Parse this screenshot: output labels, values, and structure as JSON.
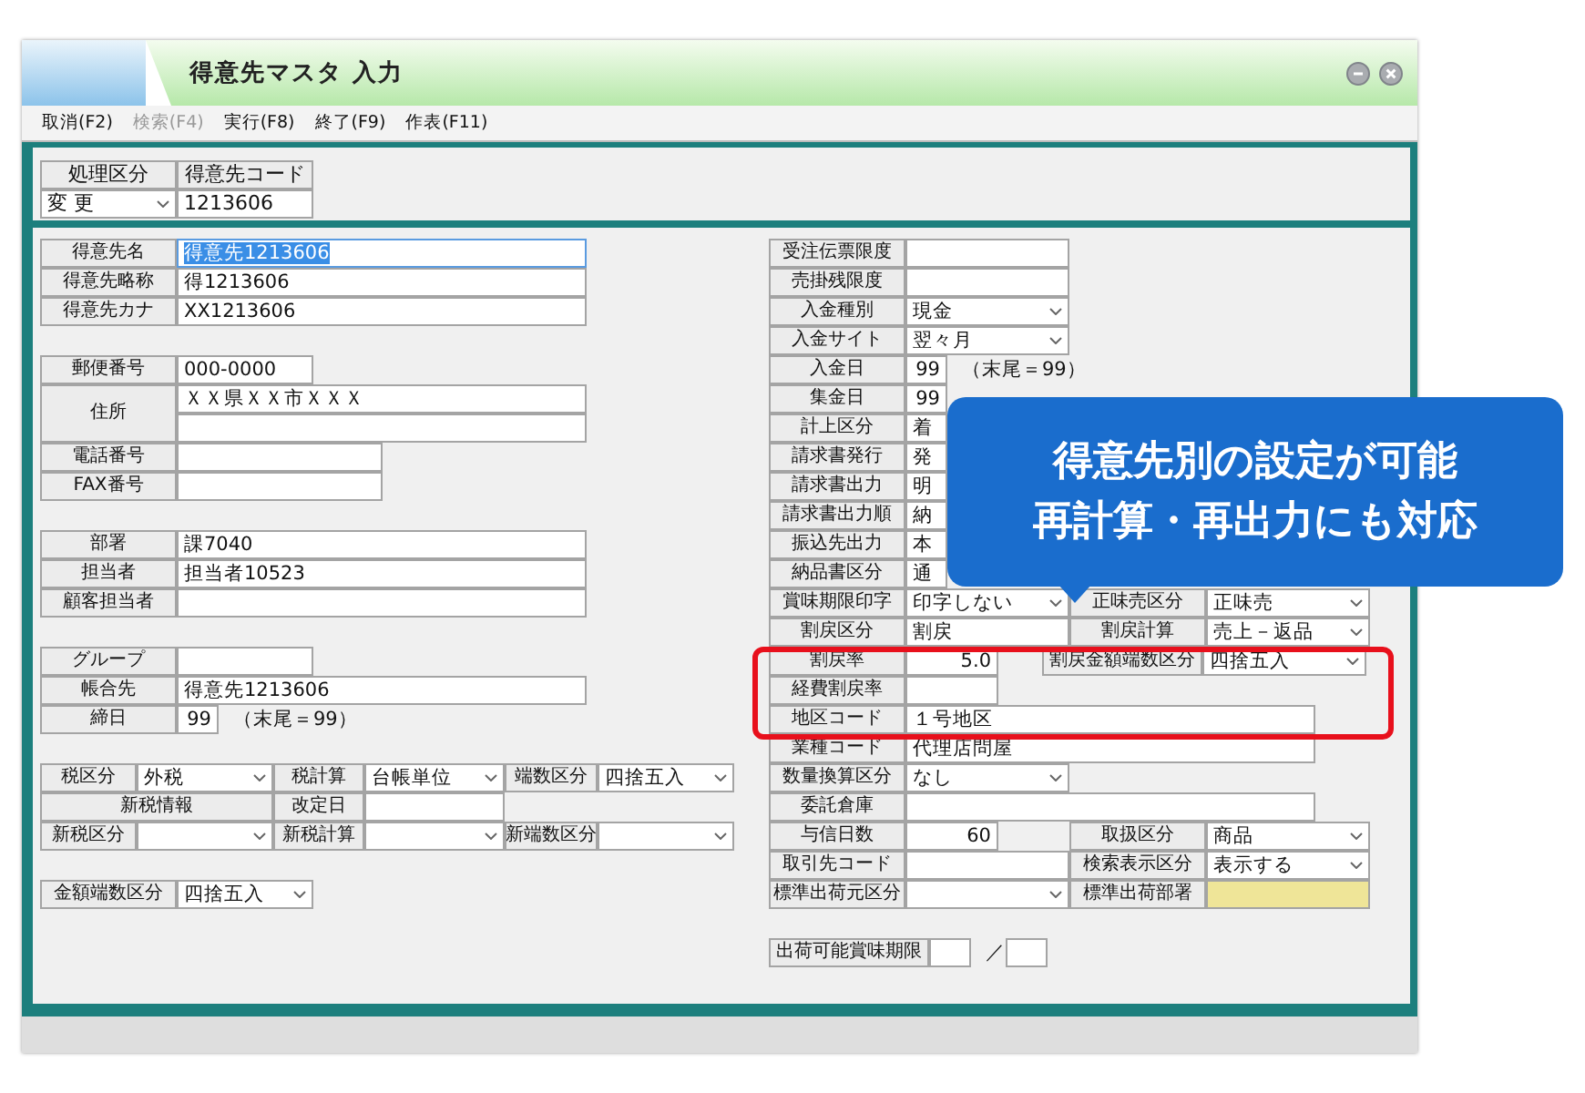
{
  "window": {
    "title": "得意先マスタ 入力"
  },
  "menu": [
    {
      "label": "取消(F2)",
      "disabled": false
    },
    {
      "label": "検索(F4)",
      "disabled": true
    },
    {
      "label": "実行(F8)",
      "disabled": false
    },
    {
      "label": "終了(F9)",
      "disabled": false
    },
    {
      "label": "作表(F11)",
      "disabled": false
    }
  ],
  "header": {
    "rows": [
      {
        "kind": "line",
        "cells": [
          {
            "kind": "label",
            "text": "処理区分"
          },
          {
            "kind": "label",
            "text": "得意先コード"
          }
        ]
      },
      {
        "kind": "line",
        "cells": [
          {
            "kind": "select",
            "value": "変 更"
          },
          {
            "kind": "input",
            "value": "1213606"
          }
        ]
      }
    ]
  },
  "left_groups": [
    [
      {
        "kind": "line",
        "cells": [
          {
            "kind": "label",
            "text": "得意先名"
          },
          {
            "kind": "input",
            "value": "得意先1213606",
            "focused": true
          }
        ]
      },
      {
        "kind": "line",
        "cells": [
          {
            "kind": "label",
            "text": "得意先略称"
          },
          {
            "kind": "input",
            "value": "得1213606",
            "focused": false
          }
        ]
      },
      {
        "kind": "line",
        "cells": [
          {
            "kind": "label",
            "text": "得意先カナ"
          },
          {
            "kind": "input",
            "value": "XX1213606",
            "focused": false
          }
        ]
      }
    ],
    [
      {
        "kind": "line",
        "cells": [
          {
            "kind": "label",
            "text": "郵便番号"
          },
          {
            "kind": "input",
            "value": "000-0000"
          }
        ]
      },
      {
        "kind": "stack",
        "cells": [
          {
            "kind": "label",
            "text": "住所"
          },
          {
            "kind": "input",
            "value": "ＸＸ県ＸＸ市ＸＸＸ"
          },
          {
            "kind": "input"
          }
        ]
      },
      {
        "kind": "line",
        "cells": [
          {
            "kind": "label",
            "text": "電話番号"
          },
          {
            "kind": "input"
          }
        ]
      },
      {
        "kind": "line",
        "cells": [
          {
            "kind": "label",
            "text": "FAX番号"
          },
          {
            "kind": "input"
          }
        ]
      }
    ],
    [
      {
        "kind": "line",
        "cells": [
          {
            "kind": "label",
            "text": "部署"
          },
          {
            "kind": "input",
            "value": "課7040"
          }
        ]
      },
      {
        "kind": "line",
        "cells": [
          {
            "kind": "label",
            "text": "担当者"
          },
          {
            "kind": "input",
            "value": "担当者10523"
          }
        ]
      },
      {
        "kind": "line",
        "cells": [
          {
            "kind": "label",
            "text": "顧客担当者"
          },
          {
            "kind": "input"
          }
        ]
      }
    ],
    [
      {
        "kind": "line",
        "cells": [
          {
            "kind": "label",
            "text": "グループ"
          },
          {
            "kind": "input"
          }
        ]
      },
      {
        "kind": "line",
        "cells": [
          {
            "kind": "label",
            "text": "帳合先"
          },
          {
            "kind": "input",
            "value": "得意先1213606"
          }
        ]
      },
      {
        "kind": "line",
        "cells": [
          {
            "kind": "label",
            "text": "締日"
          },
          {
            "kind": "number",
            "value": "99"
          },
          {
            "kind": "note",
            "text": "（末尾＝99）"
          }
        ]
      }
    ],
    [
      {
        "kind": "line",
        "cells": [
          {
            "kind": "label",
            "text": "税区分"
          },
          {
            "kind": "select",
            "value": "外税"
          },
          {
            "kind": "label",
            "text": "税計算"
          },
          {
            "kind": "select",
            "value": "台帳単位"
          },
          {
            "kind": "label",
            "text": "端数区分"
          },
          {
            "kind": "select",
            "value": "四捨五入"
          }
        ]
      },
      {
        "kind": "line",
        "cells": [
          {
            "kind": "label",
            "text": "新税情報"
          },
          {
            "kind": "label",
            "text": "改定日"
          },
          {
            "kind": "input"
          }
        ]
      },
      {
        "kind": "line",
        "cells": [
          {
            "kind": "label",
            "text": "新税区分"
          },
          {
            "kind": "select"
          },
          {
            "kind": "label",
            "text": "新税計算"
          },
          {
            "kind": "select"
          },
          {
            "kind": "label",
            "text": "新端数区分"
          },
          {
            "kind": "select"
          }
        ]
      }
    ],
    [
      {
        "kind": "line",
        "cells": [
          {
            "kind": "label",
            "text": "金額端数区分"
          },
          {
            "kind": "select",
            "value": "四捨五入"
          }
        ]
      }
    ]
  ],
  "right_rows": [
    {
      "kind": "line",
      "cells": [
        {
          "kind": "label",
          "text": "受注伝票限度"
        },
        {
          "kind": "input"
        }
      ]
    },
    {
      "kind": "line",
      "cells": [
        {
          "kind": "label",
          "text": "売掛残限度"
        },
        {
          "kind": "input"
        }
      ]
    },
    {
      "kind": "line",
      "cells": [
        {
          "kind": "label",
          "text": "入金種別"
        },
        {
          "kind": "select",
          "value": "現金"
        }
      ]
    },
    {
      "kind": "line",
      "cells": [
        {
          "kind": "label",
          "text": "入金サイト"
        },
        {
          "kind": "select",
          "value": "翌々月"
        }
      ]
    },
    {
      "kind": "line",
      "cells": [
        {
          "kind": "label",
          "text": "入金日"
        },
        {
          "kind": "number",
          "value": "99"
        },
        {
          "kind": "note",
          "text": "（末尾＝99）"
        }
      ]
    },
    {
      "kind": "line",
      "cells": [
        {
          "kind": "label",
          "text": "集金日"
        },
        {
          "kind": "number",
          "value": "99"
        }
      ]
    },
    {
      "kind": "line",
      "cells": [
        {
          "kind": "label",
          "text": "計上区分"
        },
        {
          "kind": "input",
          "value": "着"
        }
      ]
    },
    {
      "kind": "line",
      "cells": [
        {
          "kind": "label",
          "text": "請求書発行"
        },
        {
          "kind": "input",
          "value": "発"
        }
      ]
    },
    {
      "kind": "line",
      "cells": [
        {
          "kind": "label",
          "text": "請求書出力"
        },
        {
          "kind": "input",
          "value": "明"
        }
      ]
    },
    {
      "kind": "line",
      "cells": [
        {
          "kind": "label",
          "text": "請求書出力順"
        },
        {
          "kind": "input",
          "value": "納"
        }
      ]
    },
    {
      "kind": "line",
      "cells": [
        {
          "kind": "label",
          "text": "振込先出力"
        },
        {
          "kind": "input",
          "value": "本"
        }
      ]
    },
    {
      "kind": "line",
      "cells": [
        {
          "kind": "label",
          "text": "納品書区分"
        },
        {
          "kind": "input",
          "value": "通"
        }
      ]
    },
    {
      "kind": "line",
      "cells": [
        {
          "kind": "label",
          "text": "賞味期限印字"
        },
        {
          "kind": "select",
          "value": "印字しない"
        },
        {
          "kind": "label",
          "text": "正味売区分"
        },
        {
          "kind": "select",
          "value": "正味売"
        }
      ]
    },
    {
      "kind": "line",
      "cells": [
        {
          "kind": "label",
          "text": "割戻区分"
        },
        {
          "kind": "input",
          "value": "割戻"
        },
        {
          "kind": "label",
          "text": "割戻計算"
        },
        {
          "kind": "select",
          "value": "売上－返品"
        }
      ]
    },
    {
      "kind": "line",
      "cells": [
        {
          "kind": "label",
          "text": "割戻率"
        },
        {
          "kind": "number",
          "value": "5.0"
        },
        {
          "kind": "label",
          "text": "割戻金額端数区分"
        },
        {
          "kind": "select",
          "value": "四捨五入"
        }
      ]
    },
    {
      "kind": "line",
      "cells": [
        {
          "kind": "label",
          "text": "経費割戻率"
        },
        {
          "kind": "number"
        }
      ]
    },
    {
      "kind": "line",
      "cells": [
        {
          "kind": "label",
          "text": "地区コード"
        },
        {
          "kind": "input",
          "value": "１号地区"
        }
      ]
    },
    {
      "kind": "line",
      "cells": [
        {
          "kind": "label",
          "text": "業種コード"
        },
        {
          "kind": "input",
          "value": "代理店問屋"
        }
      ]
    },
    {
      "kind": "line",
      "cells": [
        {
          "kind": "label",
          "text": "数量換算区分"
        },
        {
          "kind": "select",
          "value": "なし"
        }
      ]
    },
    {
      "kind": "line",
      "cells": [
        {
          "kind": "label",
          "text": "委託倉庫"
        },
        {
          "kind": "input"
        }
      ]
    },
    {
      "kind": "line",
      "cells": [
        {
          "kind": "label",
          "text": "与信日数"
        },
        {
          "kind": "number",
          "value": "60"
        },
        {
          "kind": "label",
          "text": "取扱区分"
        },
        {
          "kind": "select",
          "value": "商品"
        }
      ]
    },
    {
      "kind": "line",
      "cells": [
        {
          "kind": "label",
          "text": "取引先コード"
        },
        {
          "kind": "input"
        },
        {
          "kind": "label",
          "text": "検索表示区分"
        },
        {
          "kind": "select",
          "value": "表示する"
        }
      ]
    },
    {
      "kind": "line",
      "cells": [
        {
          "kind": "label",
          "text": "標準出荷元区分"
        },
        {
          "kind": "select"
        },
        {
          "kind": "label",
          "text": "標準出荷部署"
        },
        {
          "kind": "input",
          "required": true
        }
      ]
    }
  ],
  "bottom_row": {
    "kind": "line",
    "cells": [
      {
        "kind": "label",
        "text": "出荷可能賞味期限"
      },
      {
        "kind": "input"
      },
      {
        "kind": "note",
        "text": "／"
      },
      {
        "kind": "input"
      }
    ]
  },
  "callout": {
    "lines": [
      "得意先別の設定が可能",
      "再計算・再出力にも対応"
    ]
  }
}
